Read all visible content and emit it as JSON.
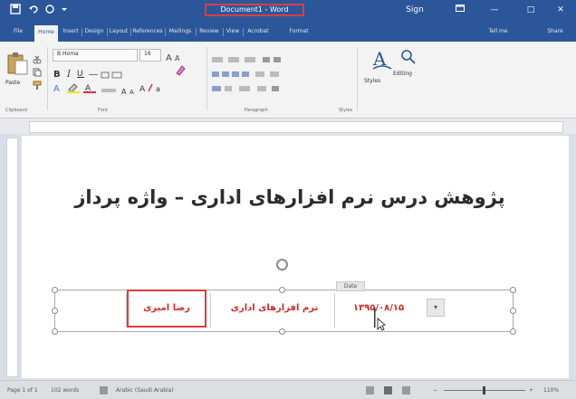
{
  "window": {
    "title": "Document1 - Word"
  },
  "titlebar": {
    "sign_in": "Sign in",
    "minimize": "—",
    "restore": "□",
    "close": "✕"
  },
  "ribbon_tabs": [
    "File",
    "Home",
    "Insert",
    "Design",
    "Layout",
    "References",
    "Mailings",
    "Review",
    "View",
    "Acrobat",
    "Format"
  ],
  "ribbon_right": {
    "tell_me": "Tell me",
    "share": "Share"
  },
  "ribbon": {
    "paste_label": "Paste",
    "font_name": "B Homa",
    "font_size": "16",
    "styles_label": "Styles",
    "editing_label": "Editing",
    "groups": [
      "Clipboard",
      "Font",
      "Paragraph",
      "Styles"
    ]
  },
  "document": {
    "heading": "پژوهش درس نرم افزارهای اداری – واژه پرداز",
    "table": {
      "name_cell": "رضا امیری",
      "course_cell": "نرم افزارهای اداری",
      "date_cell": "۱۳۹۵/۰۸/۱۵",
      "date_tag": "Date",
      "dropdown_arrow": "▾"
    }
  },
  "statusbar": {
    "page": "Page 1 of 1",
    "words": "102 words",
    "language": "Arabic (Saudi Arabia)",
    "zoom": "110%"
  },
  "colors": {
    "title_bar": "#2b579a",
    "ribbon_bg": "#f3f3f3",
    "highlight_red": "#e23b3b",
    "table_text_red": "#d42a2a"
  },
  "icons": [
    "save-icon",
    "undo-icon",
    "redo-icon",
    "paste-icon",
    "styles-icon",
    "find-icon",
    "cursor-icon"
  ]
}
